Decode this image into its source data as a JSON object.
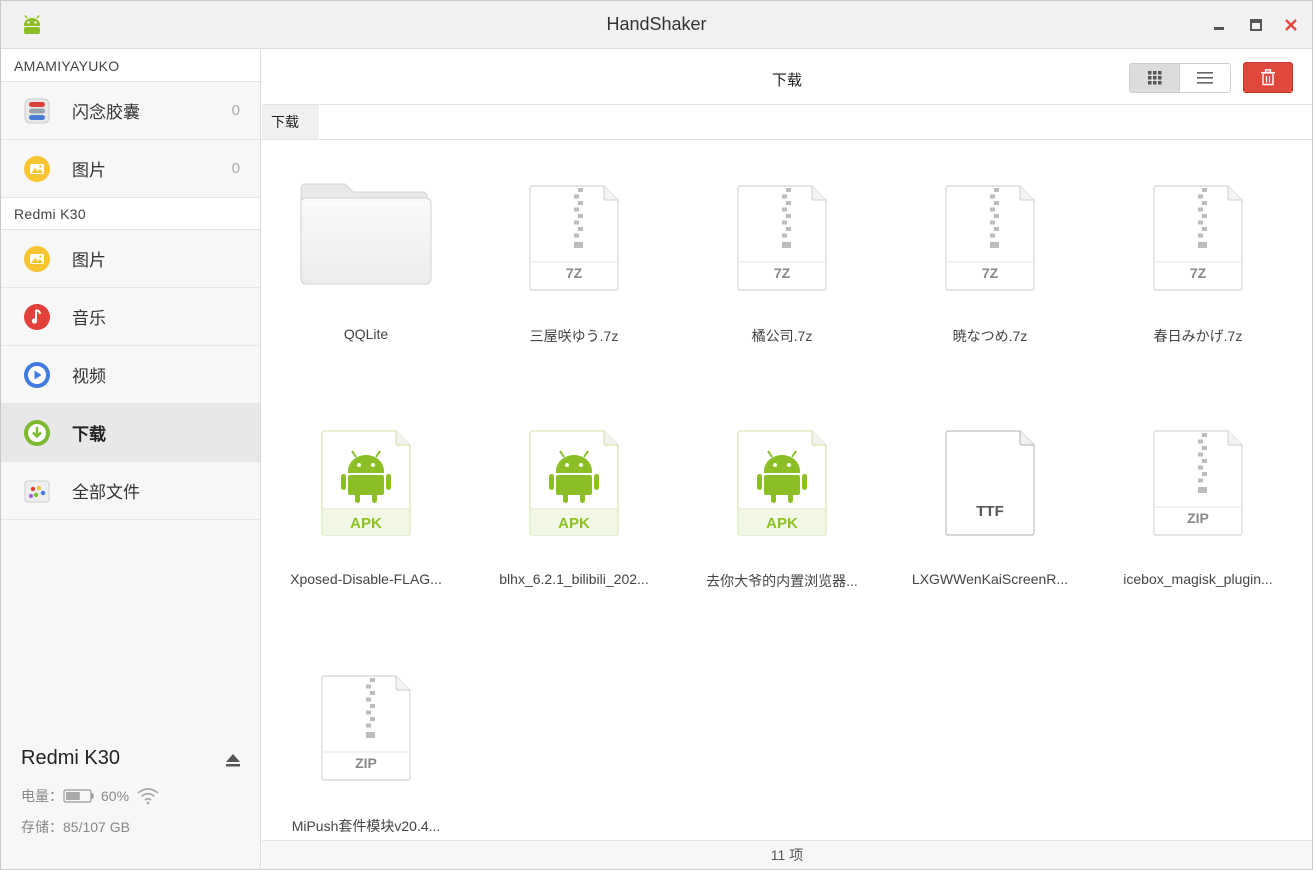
{
  "window": {
    "title": "HandShaker"
  },
  "sidebar": {
    "sections": [
      {
        "header": "AMAMIYAYUKO",
        "items": [
          {
            "label": "闪念胶囊",
            "count": "0",
            "icon": "capsule-icon"
          },
          {
            "label": "图片",
            "count": "0",
            "icon": "pictures-icon"
          }
        ]
      },
      {
        "header": "Redmi K30",
        "items": [
          {
            "label": "图片",
            "icon": "pictures-icon"
          },
          {
            "label": "音乐",
            "icon": "music-icon"
          },
          {
            "label": "视频",
            "icon": "video-icon"
          },
          {
            "label": "下载",
            "icon": "download-icon",
            "active": true
          },
          {
            "label": "全部文件",
            "icon": "all-files-icon"
          }
        ]
      }
    ],
    "device": {
      "name": "Redmi K30",
      "battery_label": "电量：",
      "battery_percent": "60%",
      "battery_level": 0.6,
      "storage_text": "存储：85/107 GB"
    }
  },
  "toolbar": {
    "title": "下载",
    "view_mode": "grid"
  },
  "breadcrumb": [
    "下载"
  ],
  "files": [
    {
      "name": "QQLite",
      "type": "folder"
    },
    {
      "name": "三屋咲ゆう.7z",
      "type": "zip",
      "ext": "7Z"
    },
    {
      "name": "橘公司.7z",
      "type": "zip",
      "ext": "7Z"
    },
    {
      "name": "暁なつめ.7z",
      "type": "zip",
      "ext": "7Z"
    },
    {
      "name": "春日みかげ.7z",
      "type": "zip",
      "ext": "7Z"
    },
    {
      "name": "Xposed-Disable-FLAG...",
      "type": "apk",
      "ext": "APK"
    },
    {
      "name": "blhx_6.2.1_bilibili_202...",
      "type": "apk",
      "ext": "APK"
    },
    {
      "name": "去你大爷的内置浏览器...",
      "type": "apk",
      "ext": "APK"
    },
    {
      "name": "LXGWWenKaiScreenR...",
      "type": "font",
      "ext": "TTF"
    },
    {
      "name": "icebox_magisk_plugin...",
      "type": "zip",
      "ext": "ZIP"
    },
    {
      "name": "MiPush套件模块v20.4...",
      "type": "zip",
      "ext": "ZIP"
    }
  ],
  "status": {
    "count_text": "11 项"
  },
  "colors": {
    "accent_red": "#e0483e",
    "android_green": "#8cbf26",
    "active_bg": "#e8e8e8"
  }
}
